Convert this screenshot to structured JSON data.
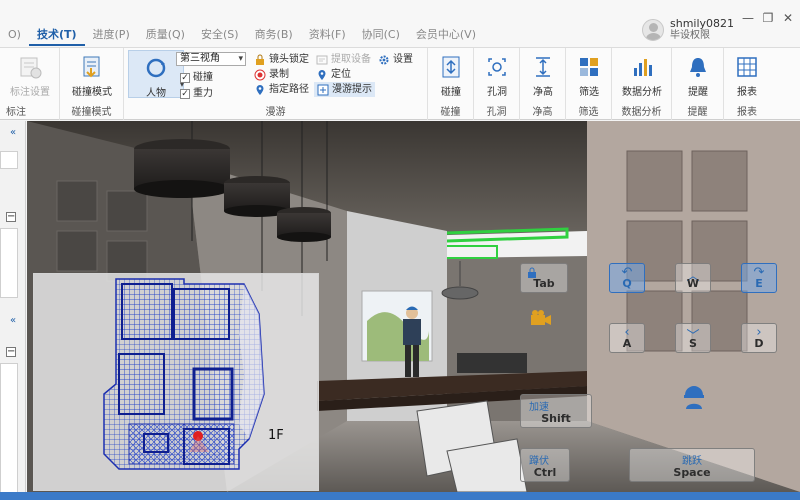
{
  "tabs": [
    {
      "label": "O)",
      "active": false
    },
    {
      "label": "技术(T)",
      "active": true
    },
    {
      "label": "进度(P)",
      "active": false
    },
    {
      "label": "质量(Q)",
      "active": false
    },
    {
      "label": "安全(S)",
      "active": false
    },
    {
      "label": "商务(B)",
      "active": false
    },
    {
      "label": "资料(F)",
      "active": false
    },
    {
      "label": "协同(C)",
      "active": false
    },
    {
      "label": "会员中心(V)",
      "active": false
    }
  ],
  "user": {
    "name": "shmily0821",
    "role": "毕设权限"
  },
  "window": {
    "minimize": "—",
    "restore": "❐",
    "close": "✕"
  },
  "ribbon": {
    "annotate": {
      "button": "标注设置",
      "group": "标注"
    },
    "collision_mode": {
      "button": "碰撞模式",
      "group": "碰撞模式"
    },
    "roam": {
      "group": "漫游",
      "character": "人物",
      "view_select": "第三视角",
      "collision_check": "碰撞",
      "gravity_check": "重力",
      "lock_camera": "镜头锁定",
      "record": "录制",
      "set_path": "指定路径",
      "pick_device": "提取设备",
      "locate": "定位",
      "roam_tip": "漫游提示",
      "settings": "设置"
    },
    "collision": {
      "button": "碰撞",
      "group": "碰撞"
    },
    "hole": {
      "button": "孔洞",
      "group": "孔洞"
    },
    "clearance": {
      "button": "净高",
      "group": "净高"
    },
    "filter": {
      "button": "筛选",
      "group": "筛选"
    },
    "analysis": {
      "button": "数据分析",
      "group": "数据分析"
    },
    "remind": {
      "button": "提醒",
      "group": "提醒"
    },
    "report": {
      "button": "报表",
      "group": "报表"
    }
  },
  "left_panel": {
    "collapse1": "«",
    "collapse2": "«",
    "minus": "−"
  },
  "viewport": {
    "floor": "1F"
  },
  "controls": {
    "tab": {
      "cn": "",
      "key": "Tab"
    },
    "q": {
      "key": "Q",
      "arrow": "↶"
    },
    "w": {
      "key": "W",
      "arrow": "︿"
    },
    "e": {
      "key": "E",
      "arrow": "↷"
    },
    "a": {
      "key": "A",
      "arrow": "‹"
    },
    "s": {
      "key": "S",
      "arrow": "﹀"
    },
    "d": {
      "key": "D",
      "arrow": "›"
    },
    "shift": {
      "cn": "加速",
      "key": "Shift"
    },
    "ctrl": {
      "cn": "蹲伏",
      "key": "Ctrl"
    },
    "space": {
      "cn": "跳跃",
      "key": "Space"
    }
  },
  "colors": {
    "accent": "#1f5fa8",
    "key_blue": "#2f6fbf",
    "status_bar": "#3b7ac8"
  }
}
